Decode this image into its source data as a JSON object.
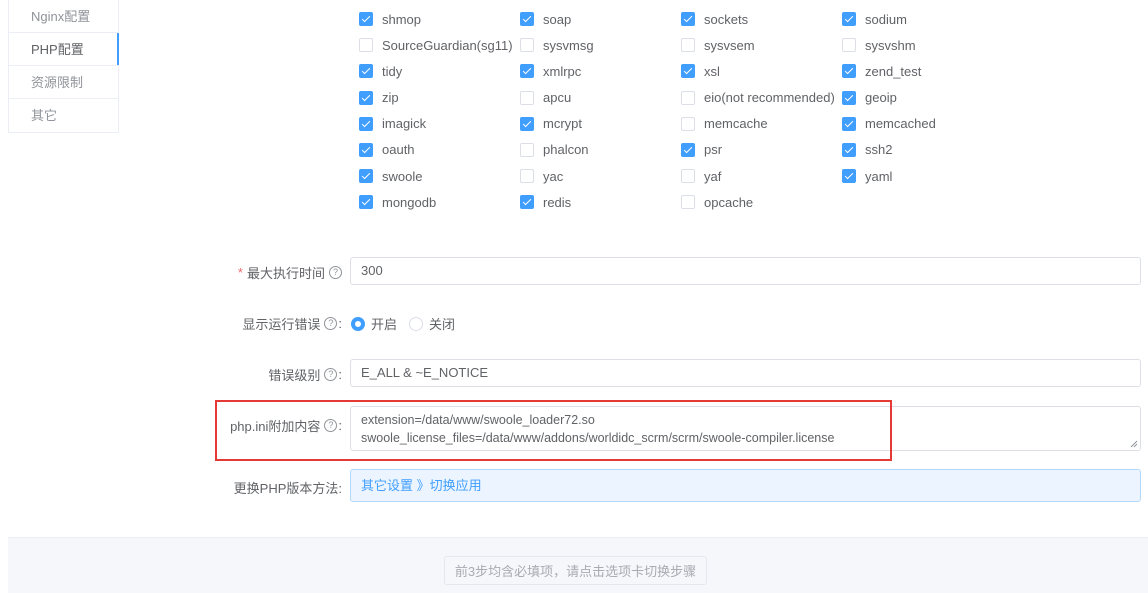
{
  "sidebar": {
    "items": [
      {
        "label": "Nginx配置",
        "active": false
      },
      {
        "label": "PHP配置",
        "active": true
      },
      {
        "label": "资源限制",
        "active": false
      },
      {
        "label": "其它",
        "active": false
      }
    ]
  },
  "extensions": [
    {
      "name": "shmop",
      "checked": true
    },
    {
      "name": "soap",
      "checked": true
    },
    {
      "name": "sockets",
      "checked": true
    },
    {
      "name": "sodium",
      "checked": true
    },
    {
      "name": "SourceGuardian(sg11)",
      "checked": false
    },
    {
      "name": "sysvmsg",
      "checked": false
    },
    {
      "name": "sysvsem",
      "checked": false
    },
    {
      "name": "sysvshm",
      "checked": false
    },
    {
      "name": "tidy",
      "checked": true
    },
    {
      "name": "xmlrpc",
      "checked": true
    },
    {
      "name": "xsl",
      "checked": true
    },
    {
      "name": "zend_test",
      "checked": true
    },
    {
      "name": "zip",
      "checked": true
    },
    {
      "name": "apcu",
      "checked": false
    },
    {
      "name": "eio(not recommended)",
      "checked": false
    },
    {
      "name": "geoip",
      "checked": true
    },
    {
      "name": "imagick",
      "checked": true
    },
    {
      "name": "mcrypt",
      "checked": true
    },
    {
      "name": "memcache",
      "checked": false
    },
    {
      "name": "memcached",
      "checked": true
    },
    {
      "name": "oauth",
      "checked": true
    },
    {
      "name": "phalcon",
      "checked": false
    },
    {
      "name": "psr",
      "checked": true
    },
    {
      "name": "ssh2",
      "checked": true
    },
    {
      "name": "swoole",
      "checked": true
    },
    {
      "name": "yac",
      "checked": false
    },
    {
      "name": "yaf",
      "checked": false
    },
    {
      "name": "yaml",
      "checked": true
    },
    {
      "name": "mongodb",
      "checked": true
    },
    {
      "name": "redis",
      "checked": true
    },
    {
      "name": "opcache",
      "checked": false
    }
  ],
  "form": {
    "max_exec_time": {
      "required_mark": "*",
      "label": "最大执行时间",
      "value": "300"
    },
    "display_errors": {
      "label": "显示运行错误",
      "colon": ":",
      "options": [
        {
          "label": "开启",
          "checked": true
        },
        {
          "label": "关闭",
          "checked": false
        }
      ]
    },
    "error_level": {
      "label": "错误级别",
      "colon": ":",
      "value": "E_ALL & ~E_NOTICE"
    },
    "php_ini_extra": {
      "label": "php.ini附加内容",
      "colon": ":",
      "lines": [
        "extension=/data/www/swoole_loader72.so",
        "swoole_license_files=/data/www/addons/worldidc_scrm/scrm/swoole-compiler.license"
      ]
    },
    "switch_php": {
      "label": "更换PHP版本方法:",
      "link_text": "其它设置 》切换应用"
    }
  },
  "help_icon_glyph": "?",
  "footer": {
    "button_label": "前3步均含必填项，请点击选项卡切换步骤"
  },
  "colors": {
    "accent": "#409eff",
    "required": "#f56c6c",
    "highlight_border": "#e53935"
  }
}
